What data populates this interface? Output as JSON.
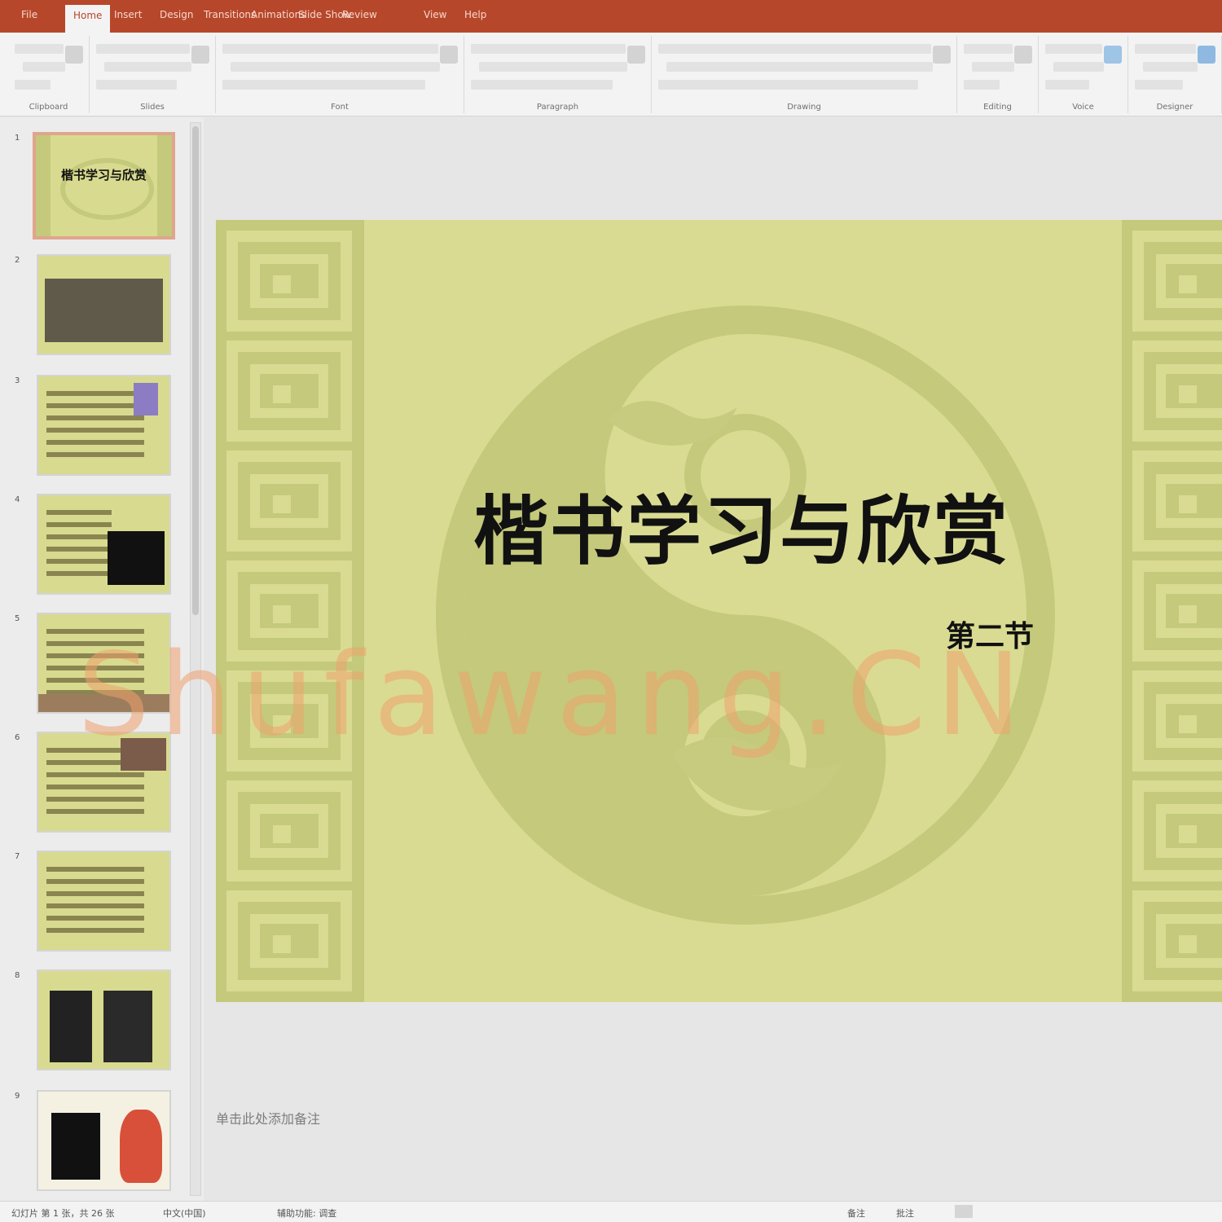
{
  "colors": {
    "accent": "#b7472a",
    "slide_bg": "#d9db92",
    "slide_pattern": "#c4c97b",
    "watermark": "#efa06e"
  },
  "tabs": [
    "File",
    "Home",
    "Insert",
    "Design",
    "Transitions",
    "Animations",
    "Slide Show",
    "Review",
    "View",
    "Help"
  ],
  "active_tab_index": 1,
  "ribbon": {
    "groups": [
      "Clipboard",
      "Slides",
      "Font",
      "Paragraph",
      "Drawing",
      "Editing",
      "Voice",
      "Designer"
    ]
  },
  "thumbnails": [
    {
      "num": "1",
      "title": "楷书学习与欣赏"
    },
    {
      "num": "2",
      "title": ""
    },
    {
      "num": "3",
      "title": ""
    },
    {
      "num": "4",
      "title": ""
    },
    {
      "num": "5",
      "title": ""
    },
    {
      "num": "6",
      "title": ""
    },
    {
      "num": "7",
      "title": ""
    },
    {
      "num": "8",
      "title": ""
    },
    {
      "num": "9",
      "title": ""
    }
  ],
  "slide": {
    "title": "楷书学习与欣赏",
    "subtitle": "第二节"
  },
  "watermark_text": "Shufawang.CN",
  "notes_placeholder": "单击此处添加备注",
  "status": {
    "left_info": "幻灯片 第 1 张，共 26 张",
    "language": "中文(中国)",
    "accessibility": "辅助功能: 调查",
    "notes_btn": "备注",
    "comments_btn": "批注"
  }
}
